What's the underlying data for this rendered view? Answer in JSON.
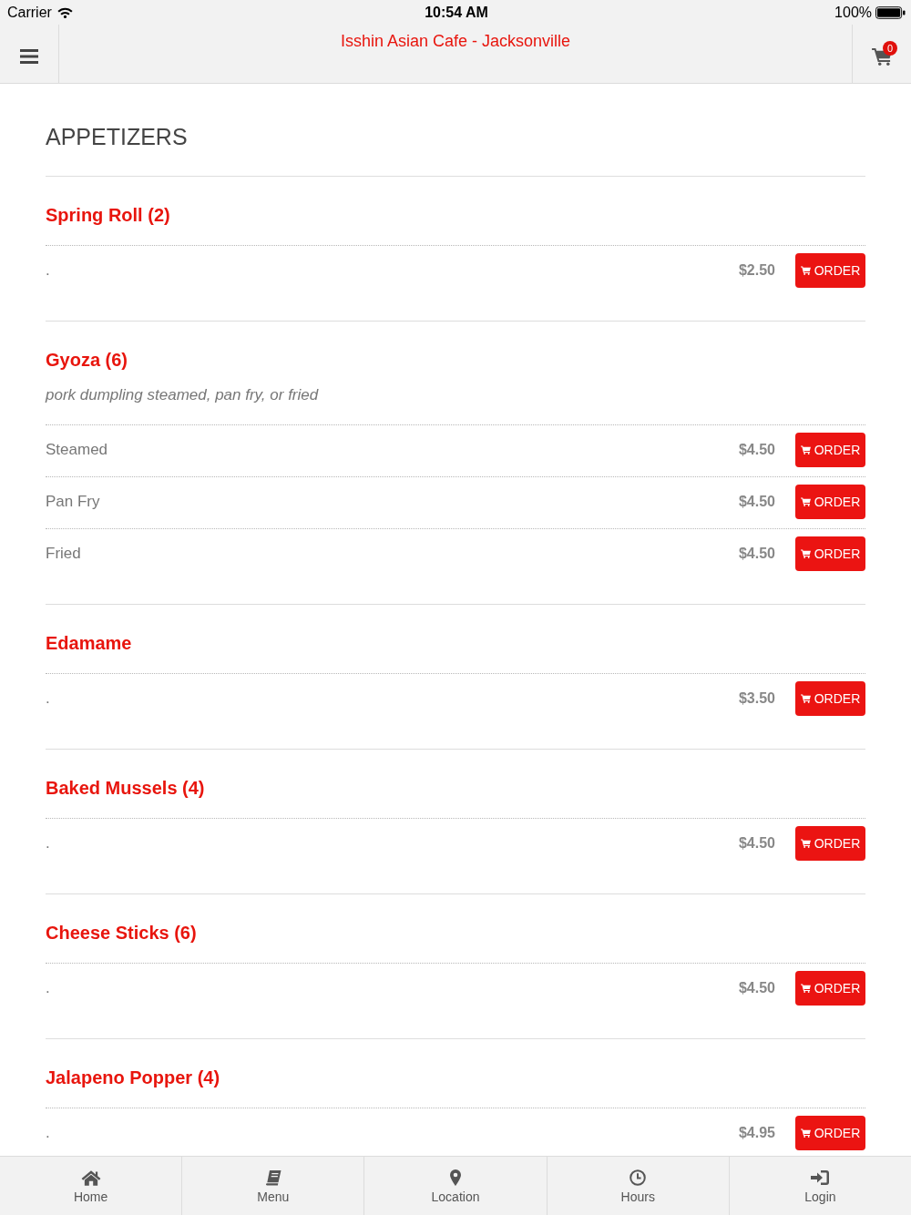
{
  "status_bar": {
    "carrier": "Carrier",
    "time": "10:54 AM",
    "battery": "100%"
  },
  "header": {
    "title": "Isshin Asian Cafe - Jacksonville",
    "cart_count": "0"
  },
  "section": {
    "title": "APPETIZERS"
  },
  "items": [
    {
      "name": "Spring Roll (2)",
      "options": [
        {
          "label": ".",
          "price": "$2.50",
          "button": "ORDER"
        }
      ]
    },
    {
      "name": "Gyoza (6)",
      "description": "pork dumpling steamed, pan fry, or fried",
      "options": [
        {
          "label": "Steamed",
          "price": "$4.50",
          "button": "ORDER"
        },
        {
          "label": "Pan Fry",
          "price": "$4.50",
          "button": "ORDER"
        },
        {
          "label": "Fried",
          "price": "$4.50",
          "button": "ORDER"
        }
      ]
    },
    {
      "name": "Edamame",
      "options": [
        {
          "label": ".",
          "price": "$3.50",
          "button": "ORDER"
        }
      ]
    },
    {
      "name": "Baked Mussels (4)",
      "options": [
        {
          "label": ".",
          "price": "$4.50",
          "button": "ORDER"
        }
      ]
    },
    {
      "name": "Cheese Sticks (6)",
      "options": [
        {
          "label": ".",
          "price": "$4.50",
          "button": "ORDER"
        }
      ]
    },
    {
      "name": "Jalapeno Popper (4)",
      "options": [
        {
          "label": ".",
          "price": "$4.95",
          "button": "ORDER"
        }
      ]
    }
  ],
  "tab_bar": [
    {
      "label": "Home"
    },
    {
      "label": "Menu"
    },
    {
      "label": "Location"
    },
    {
      "label": "Hours"
    },
    {
      "label": "Login"
    }
  ]
}
